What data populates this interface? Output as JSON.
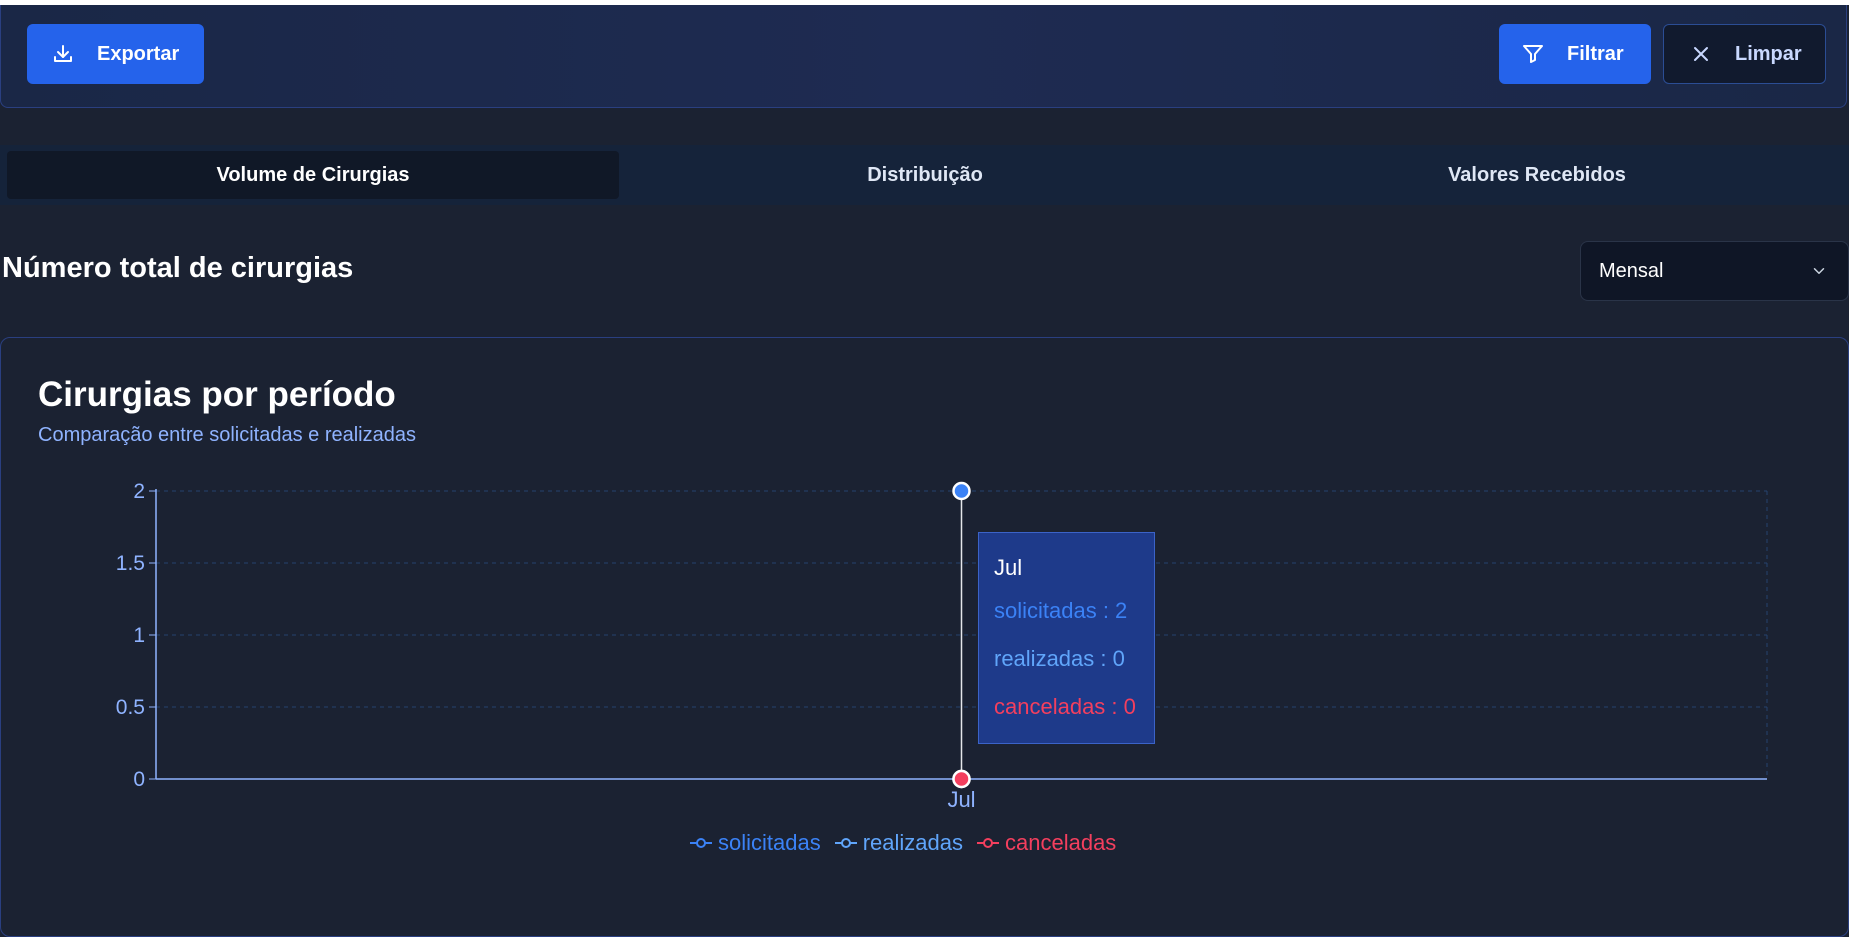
{
  "toolbar": {
    "export_label": "Exportar",
    "filter_label": "Filtrar",
    "clear_label": "Limpar"
  },
  "tabs": [
    {
      "label": "Volume de Cirurgias",
      "active": true
    },
    {
      "label": "Distribuição",
      "active": false
    },
    {
      "label": "Valores Recebidos",
      "active": false
    }
  ],
  "section": {
    "title": "Número total de cirurgias"
  },
  "period_select": {
    "value": "Mensal"
  },
  "card": {
    "title": "Cirurgias por período",
    "subtitle": "Comparação entre solicitadas e realizadas"
  },
  "colors": {
    "solicitadas": "#3b82f6",
    "realizadas": "#60a5fa",
    "canceladas": "#f43f5e",
    "accent": "#2563eb"
  },
  "chart_data": {
    "type": "line",
    "x": [
      "Jul"
    ],
    "series": [
      {
        "name": "solicitadas",
        "values": [
          2
        ]
      },
      {
        "name": "realizadas",
        "values": [
          0
        ]
      },
      {
        "name": "canceladas",
        "values": [
          0
        ]
      }
    ],
    "ylim": [
      0,
      2
    ],
    "yticks": [
      "0",
      "0.5",
      "1",
      "1.5",
      "2"
    ],
    "grid": true,
    "legend": "bottom"
  },
  "tooltip": {
    "title": "Jul",
    "rows": [
      {
        "text": "solicitadas : 2",
        "series": "solicitadas"
      },
      {
        "text": "realizadas : 0",
        "series": "realizadas"
      },
      {
        "text": "canceladas : 0",
        "series": "canceladas"
      }
    ]
  },
  "legend": {
    "items": [
      "solicitadas",
      "realizadas",
      "canceladas"
    ]
  }
}
